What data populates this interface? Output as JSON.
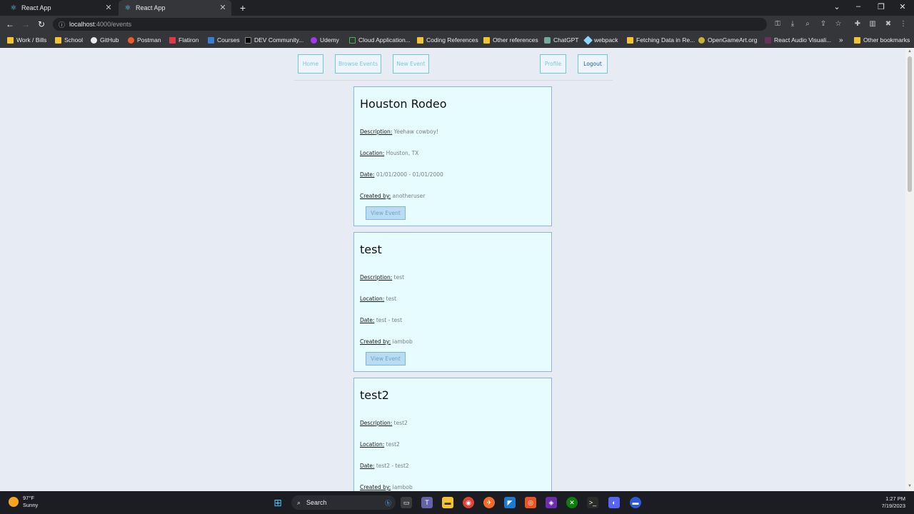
{
  "browser": {
    "tabs": [
      {
        "title": "React App"
      },
      {
        "title": "React App"
      }
    ],
    "url_host": "localhost",
    "url_path": ":4000/events",
    "bookmarks": [
      {
        "label": "Work / Bills",
        "icon": "folder-icon"
      },
      {
        "label": "School",
        "icon": "folder-icon"
      },
      {
        "label": "GitHub",
        "icon": "github-icon"
      },
      {
        "label": "Postman",
        "icon": "postman-icon"
      },
      {
        "label": "Flatiron",
        "icon": "flatiron-icon"
      },
      {
        "label": "Courses",
        "icon": "courses-icon"
      },
      {
        "label": "DEV Community...",
        "icon": "dev-icon"
      },
      {
        "label": "Udemy",
        "icon": "udemy-icon"
      },
      {
        "label": "Cloud Application...",
        "icon": "cloud-icon"
      },
      {
        "label": "Coding References",
        "icon": "folder-icon"
      },
      {
        "label": "Other references",
        "icon": "folder-icon"
      },
      {
        "label": "ChatGPT",
        "icon": "chatgpt-icon"
      },
      {
        "label": "webpack",
        "icon": "webpack-icon"
      },
      {
        "label": "Fetching Data in Re...",
        "icon": "folder-icon"
      },
      {
        "label": "OpenGameArt.org",
        "icon": "opengameart-icon"
      },
      {
        "label": "React Audio Visuali...",
        "icon": "react-audio-icon"
      },
      {
        "label": "Other bookmarks",
        "icon": "folder-icon"
      }
    ]
  },
  "nav": {
    "home": "Home",
    "browse": "Browse Events",
    "new_event": "New Event",
    "profile": "Profile",
    "logout": "Logout"
  },
  "labels": {
    "description": "Description:",
    "location": "Location:",
    "date": "Date:",
    "created_by": "Created by:",
    "view_event": "View Event"
  },
  "events": [
    {
      "title": "Houston Rodeo",
      "description": "Yeehaw cowboy!",
      "location": "Houston, TX",
      "date": "01/01/2000 - 01/01/2000",
      "created_by": "anotheruser"
    },
    {
      "title": "test",
      "description": "test",
      "location": "test",
      "date": "test - test",
      "created_by": "iambob"
    },
    {
      "title": "test2",
      "description": "test2",
      "location": "test2",
      "date": "test2 - test2",
      "created_by": "iambob"
    }
  ],
  "taskbar": {
    "temperature": "97°F",
    "condition": "Sunny",
    "search": "Search",
    "time": "1:27 PM",
    "date": "7/19/2023"
  }
}
